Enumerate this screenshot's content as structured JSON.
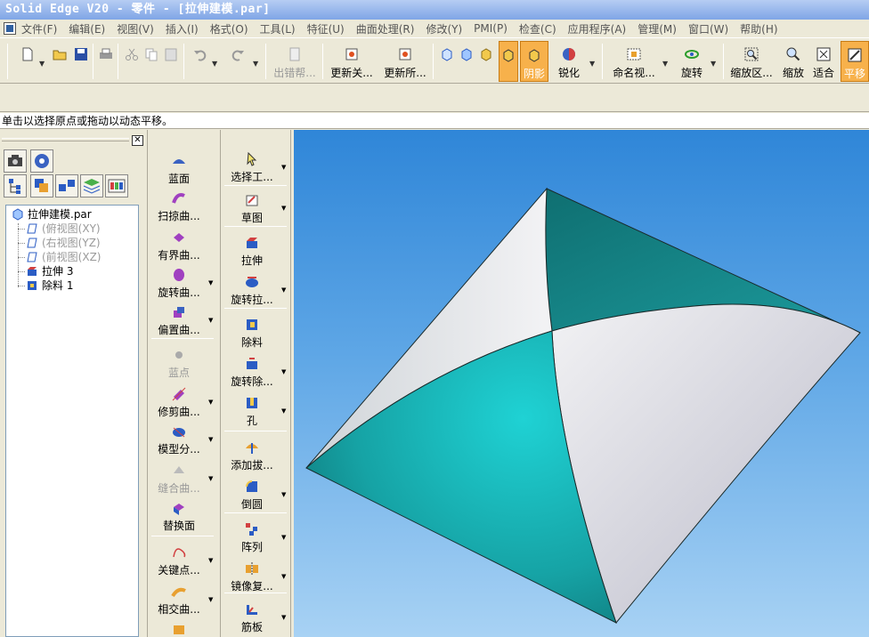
{
  "window": {
    "title": "Solid Edge V20 - 零件 - [拉伸建模.par]"
  },
  "menu": {
    "items": [
      "文件(F)",
      "编辑(E)",
      "视图(V)",
      "插入(I)",
      "格式(O)",
      "工具(L)",
      "特征(U)",
      "曲面处理(R)",
      "修改(Y)",
      "PMI(P)",
      "检查(C)",
      "应用程序(A)",
      "管理(M)",
      "窗口(W)",
      "帮助(H)"
    ]
  },
  "toolbar": {
    "error_help": "出错帮...",
    "update_related": "更新关...",
    "update_all": "更新所...",
    "shaded": "阴影",
    "sharpen": "锐化",
    "named_view": "命名视...",
    "rotate": "旋转",
    "zoom_area": "缩放区...",
    "zoom": "缩放",
    "fit": "适合",
    "pan": "平移"
  },
  "prompt": "单击以选择原点或拖动以动态平移。",
  "tree": {
    "root": "拉伸建模.par",
    "items": [
      "(俯视图(XY)",
      "(右视图(YZ)",
      "(前视图(XZ)",
      "拉伸 3",
      "除料 1"
    ]
  },
  "surface_commands": {
    "bluesurf": "蓝面",
    "sweep": "扫掠曲...",
    "bounded": "有界曲...",
    "revolve": "旋转曲...",
    "offset": "偏置曲...",
    "bluedot": "蓝点",
    "trim": "修剪曲...",
    "split": "模型分...",
    "stitch": "缝合曲...",
    "replace": "替换面",
    "keypoint": "关键点...",
    "intersect": "相交曲..."
  },
  "feature_commands": {
    "select": "选择工...",
    "sketch": "草图",
    "extrude": "拉伸",
    "revolve_extrude": "旋转拉...",
    "cutout": "除料",
    "revolve_cut": "旋转除...",
    "hole": "孔",
    "draft": "添加拔...",
    "round": "倒圆",
    "pattern": "阵列",
    "mirror": "镜像复...",
    "rib": "筋板"
  },
  "colors": {
    "teal_dark": "#157e80",
    "teal_light": "#1fc7c9",
    "white_face": "#efeff3",
    "bg_top": "#2f86d8",
    "bg_bottom": "#a8d2f4",
    "active_button": "#f7b14b"
  }
}
